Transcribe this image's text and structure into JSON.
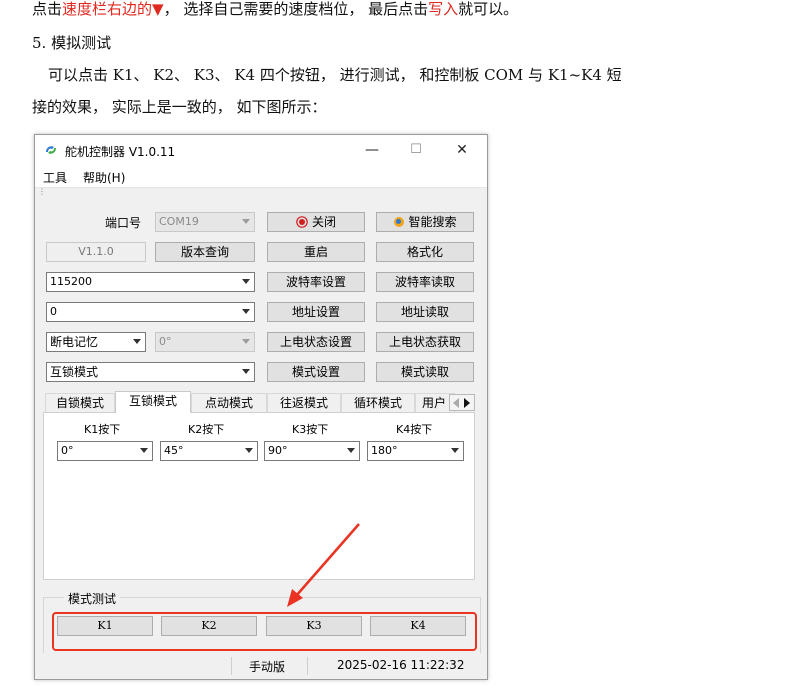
{
  "doc": {
    "line1_a": "点击",
    "line1_red1": "速度栏右边的▼",
    "line1_b": "，  选择自己需要的速度档位，  最后点击",
    "line1_red2": "写入",
    "line1_c": "就可以。",
    "section_title": "5. 模拟测试",
    "para_line1": "可以点击 K1、 K2、 K3、 K4 四个按钮， 进行测试， 和控制板 COM 与 K1~K4 短",
    "para_line2": "接的效果， 实际上是一致的， 如下图所示："
  },
  "window": {
    "title": "舵机控制器 V1.0.11",
    "minimize": "—",
    "maximize": "☐",
    "close": "✕",
    "menu": [
      "工具",
      "帮助(H)"
    ]
  },
  "panel": {
    "port_label": "端口号",
    "port_value": "COM19",
    "close_button": "关闭",
    "smart_search_button": "智能搜索",
    "version_field": "V1.1.0",
    "version_query_button": "版本查询",
    "restart_button": "重启",
    "format_button": "格式化",
    "baud_value": "115200",
    "baud_set_button": "波特率设置",
    "baud_read_button": "波特率读取",
    "address_value": "0",
    "address_set_button": "地址设置",
    "address_read_button": "地址读取",
    "poweroff_memory": "断电记忆",
    "angle_value": "0°",
    "power_state_set_button": "上电状态设置",
    "power_state_get_button": "上电状态获取",
    "mode_value": "互锁模式",
    "mode_set_button": "模式设置",
    "mode_read_button": "模式读取"
  },
  "tabs": [
    "自锁模式",
    "互锁模式",
    "点动模式",
    "往返模式",
    "循环模式",
    "用户"
  ],
  "active_tab": 1,
  "keys": [
    {
      "label": "K1按下",
      "value": "0°"
    },
    {
      "label": "K2按下",
      "value": "45°"
    },
    {
      "label": "K3按下",
      "value": "90°"
    },
    {
      "label": "K4按下",
      "value": "180°"
    }
  ],
  "test_group": {
    "title": "模式测试",
    "buttons": [
      "K1",
      "K2",
      "K3",
      "K4"
    ]
  },
  "status": {
    "mode": "手动版",
    "datetime": "2025-02-16 11:22:32"
  },
  "colors": {
    "highlight_red": "#e0291f",
    "annotation_red": "#ea3323"
  }
}
